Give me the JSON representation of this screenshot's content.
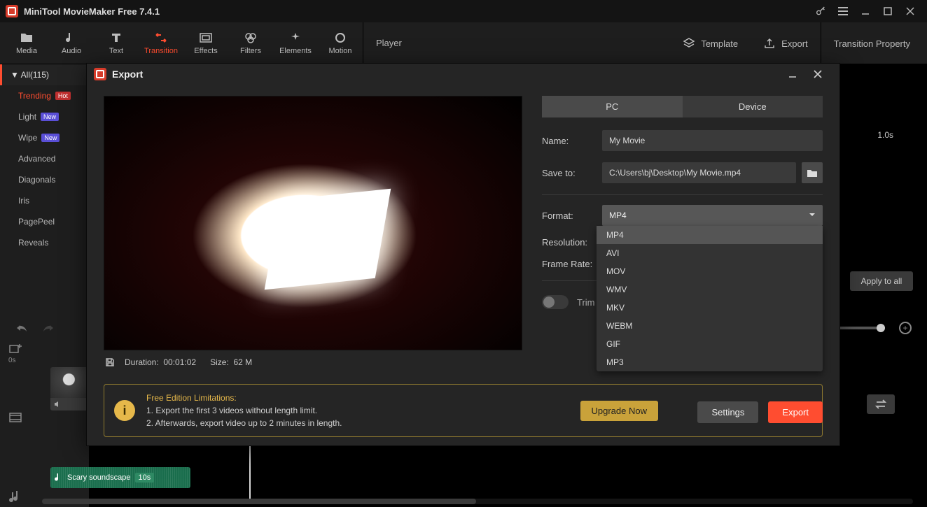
{
  "titlebar": {
    "app_title": "MiniTool MovieMaker Free 7.4.1"
  },
  "tabs": {
    "media": "Media",
    "audio": "Audio",
    "text": "Text",
    "transition": "Transition",
    "effects": "Effects",
    "filters": "Filters",
    "elements": "Elements",
    "motion": "Motion"
  },
  "topright": {
    "player": "Player",
    "template": "Template",
    "export": "Export",
    "property": "Transition Property",
    "time_marker": "1.0s"
  },
  "sidebar": {
    "all": "All(115)",
    "items": [
      {
        "label": "Trending",
        "badge": "Hot",
        "badge_kind": "hot",
        "active": true
      },
      {
        "label": "Light",
        "badge": "New",
        "badge_kind": "new"
      },
      {
        "label": "Wipe",
        "badge": "New",
        "badge_kind": "new"
      },
      {
        "label": "Advanced"
      },
      {
        "label": "Diagonals"
      },
      {
        "label": "Iris"
      },
      {
        "label": "PagePeel"
      },
      {
        "label": "Reveals"
      }
    ]
  },
  "apply_all": "Apply to all",
  "timeline": {
    "zero": "0s",
    "audio_clip_name": "Scary soundscape",
    "audio_clip_dur": "10s"
  },
  "dialog": {
    "title": "Export",
    "tabs": {
      "pc": "PC",
      "device": "Device"
    },
    "name_label": "Name:",
    "name_value": "My Movie",
    "save_label": "Save to:",
    "save_value": "C:\\Users\\bj\\Desktop\\My Movie.mp4",
    "format_label": "Format:",
    "format_value": "MP4",
    "format_options": [
      "MP4",
      "AVI",
      "MOV",
      "WMV",
      "MKV",
      "WEBM",
      "GIF",
      "MP3"
    ],
    "resolution_label": "Resolution:",
    "framerate_label": "Frame Rate:",
    "trim_label": "Trim",
    "duration_label": "Duration:",
    "duration_value": "00:01:02",
    "size_label": "Size:",
    "size_value": "62 M",
    "limitations": {
      "heading": "Free Edition Limitations:",
      "line1": "1. Export the first 3 videos without length limit.",
      "line2": "2. Afterwards, export video up to 2 minutes in length.",
      "upgrade": "Upgrade Now"
    },
    "settings_btn": "Settings",
    "export_btn": "Export"
  }
}
